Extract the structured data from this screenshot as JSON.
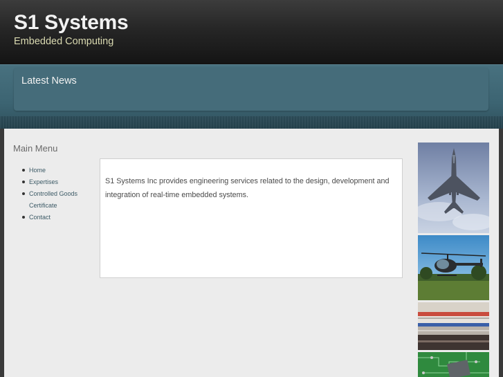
{
  "header": {
    "title": "S1 Systems",
    "tagline": "Embedded Computing"
  },
  "news": {
    "title": "Latest News"
  },
  "menu": {
    "title": "Main Menu",
    "items": [
      {
        "label": "Home"
      },
      {
        "label": "Expertises"
      },
      {
        "label": "Controlled Goods Certificate"
      },
      {
        "label": "Contact"
      }
    ]
  },
  "main": {
    "intro": "S1 Systems Inc provides engineering services related to the design, development and integration of real-time embedded systems."
  },
  "images": [
    {
      "name": "fighter-jet-photo"
    },
    {
      "name": "helicopter-photo"
    },
    {
      "name": "subway-train-photo"
    },
    {
      "name": "circuit-board-photo"
    }
  ]
}
